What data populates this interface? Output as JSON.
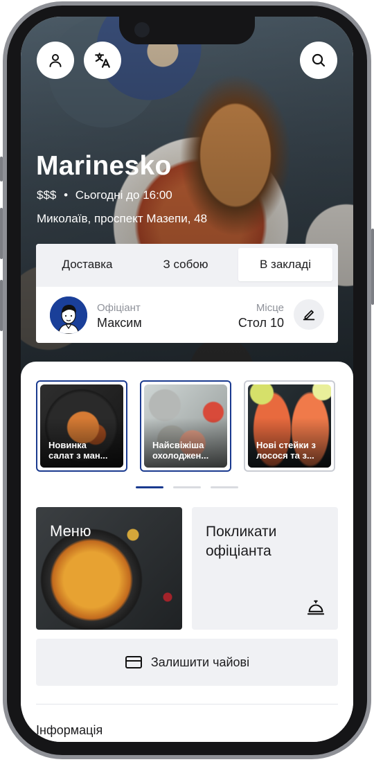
{
  "restaurant": {
    "name": "Marinesko",
    "price_level": "$$$",
    "hours": "Сьогодні до 16:00",
    "address": "Миколаїв, проспект Мазепи, 48"
  },
  "top_icons": {
    "profile": "user-icon",
    "translate": "translate-icon",
    "search": "search-icon"
  },
  "order_modes": {
    "tabs": [
      {
        "label": "Доставка"
      },
      {
        "label": "З собою"
      },
      {
        "label": "В закладі"
      }
    ],
    "active_tab": "В закладі"
  },
  "waiter": {
    "label": "Офіціант",
    "name": "Максим",
    "place_label": "Місце",
    "place_value": "Стол 10"
  },
  "stories": [
    {
      "title": "Новинка салат з мандарином",
      "line1": "Новинка",
      "line2": "салат з ман..."
    },
    {
      "title": "Найсвіжіша охолоджена риба",
      "line1": "Найсвіжіша",
      "line2": "охолоджен..."
    },
    {
      "title": "Нові стейки з лосося та з...",
      "line1": "Нові стейки з",
      "line2": "лосося та з..."
    }
  ],
  "story_pages": {
    "count": 3,
    "active": 0
  },
  "actions": {
    "menu_label": "Меню",
    "call_waiter_label": "Покликати офіціанта",
    "tips_label": "Залишити чайові"
  },
  "info": {
    "title": "Інформація"
  },
  "colors": {
    "accent": "#1a3a8f",
    "surface": "#f0f1f4",
    "text": "#1c1c1e",
    "muted": "#8e9199"
  }
}
